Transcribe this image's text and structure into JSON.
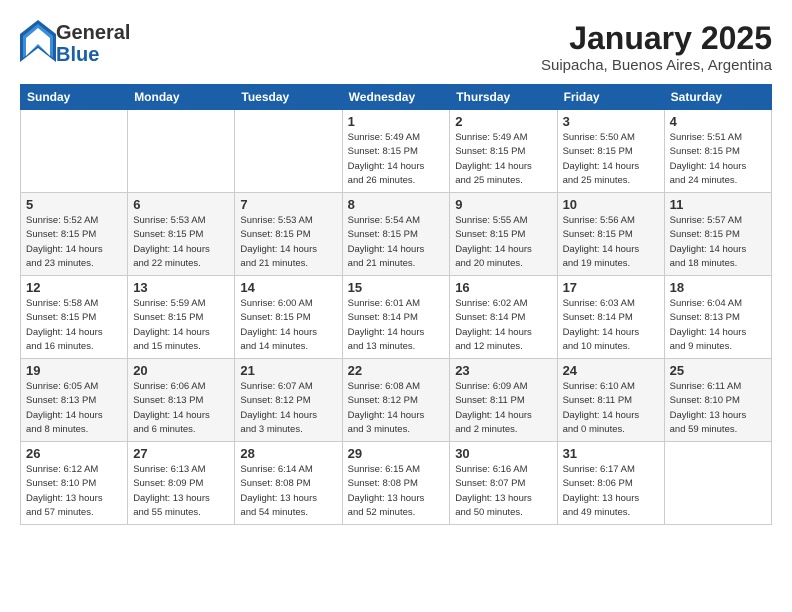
{
  "logo": {
    "general": "General",
    "blue": "Blue"
  },
  "title": "January 2025",
  "subtitle": "Suipacha, Buenos Aires, Argentina",
  "days_of_week": [
    "Sunday",
    "Monday",
    "Tuesday",
    "Wednesday",
    "Thursday",
    "Friday",
    "Saturday"
  ],
  "weeks": [
    [
      {
        "day": "",
        "info": ""
      },
      {
        "day": "",
        "info": ""
      },
      {
        "day": "",
        "info": ""
      },
      {
        "day": "1",
        "info": "Sunrise: 5:49 AM\nSunset: 8:15 PM\nDaylight: 14 hours\nand 26 minutes."
      },
      {
        "day": "2",
        "info": "Sunrise: 5:49 AM\nSunset: 8:15 PM\nDaylight: 14 hours\nand 25 minutes."
      },
      {
        "day": "3",
        "info": "Sunrise: 5:50 AM\nSunset: 8:15 PM\nDaylight: 14 hours\nand 25 minutes."
      },
      {
        "day": "4",
        "info": "Sunrise: 5:51 AM\nSunset: 8:15 PM\nDaylight: 14 hours\nand 24 minutes."
      }
    ],
    [
      {
        "day": "5",
        "info": "Sunrise: 5:52 AM\nSunset: 8:15 PM\nDaylight: 14 hours\nand 23 minutes."
      },
      {
        "day": "6",
        "info": "Sunrise: 5:53 AM\nSunset: 8:15 PM\nDaylight: 14 hours\nand 22 minutes."
      },
      {
        "day": "7",
        "info": "Sunrise: 5:53 AM\nSunset: 8:15 PM\nDaylight: 14 hours\nand 21 minutes."
      },
      {
        "day": "8",
        "info": "Sunrise: 5:54 AM\nSunset: 8:15 PM\nDaylight: 14 hours\nand 21 minutes."
      },
      {
        "day": "9",
        "info": "Sunrise: 5:55 AM\nSunset: 8:15 PM\nDaylight: 14 hours\nand 20 minutes."
      },
      {
        "day": "10",
        "info": "Sunrise: 5:56 AM\nSunset: 8:15 PM\nDaylight: 14 hours\nand 19 minutes."
      },
      {
        "day": "11",
        "info": "Sunrise: 5:57 AM\nSunset: 8:15 PM\nDaylight: 14 hours\nand 18 minutes."
      }
    ],
    [
      {
        "day": "12",
        "info": "Sunrise: 5:58 AM\nSunset: 8:15 PM\nDaylight: 14 hours\nand 16 minutes."
      },
      {
        "day": "13",
        "info": "Sunrise: 5:59 AM\nSunset: 8:15 PM\nDaylight: 14 hours\nand 15 minutes."
      },
      {
        "day": "14",
        "info": "Sunrise: 6:00 AM\nSunset: 8:15 PM\nDaylight: 14 hours\nand 14 minutes."
      },
      {
        "day": "15",
        "info": "Sunrise: 6:01 AM\nSunset: 8:14 PM\nDaylight: 14 hours\nand 13 minutes."
      },
      {
        "day": "16",
        "info": "Sunrise: 6:02 AM\nSunset: 8:14 PM\nDaylight: 14 hours\nand 12 minutes."
      },
      {
        "day": "17",
        "info": "Sunrise: 6:03 AM\nSunset: 8:14 PM\nDaylight: 14 hours\nand 10 minutes."
      },
      {
        "day": "18",
        "info": "Sunrise: 6:04 AM\nSunset: 8:13 PM\nDaylight: 14 hours\nand 9 minutes."
      }
    ],
    [
      {
        "day": "19",
        "info": "Sunrise: 6:05 AM\nSunset: 8:13 PM\nDaylight: 14 hours\nand 8 minutes."
      },
      {
        "day": "20",
        "info": "Sunrise: 6:06 AM\nSunset: 8:13 PM\nDaylight: 14 hours\nand 6 minutes."
      },
      {
        "day": "21",
        "info": "Sunrise: 6:07 AM\nSunset: 8:12 PM\nDaylight: 14 hours\nand 3 minutes."
      },
      {
        "day": "22",
        "info": "Sunrise: 6:08 AM\nSunset: 8:12 PM\nDaylight: 14 hours\nand 3 minutes."
      },
      {
        "day": "23",
        "info": "Sunrise: 6:09 AM\nSunset: 8:11 PM\nDaylight: 14 hours\nand 2 minutes."
      },
      {
        "day": "24",
        "info": "Sunrise: 6:10 AM\nSunset: 8:11 PM\nDaylight: 14 hours\nand 0 minutes."
      },
      {
        "day": "25",
        "info": "Sunrise: 6:11 AM\nSunset: 8:10 PM\nDaylight: 13 hours\nand 59 minutes."
      }
    ],
    [
      {
        "day": "26",
        "info": "Sunrise: 6:12 AM\nSunset: 8:10 PM\nDaylight: 13 hours\nand 57 minutes."
      },
      {
        "day": "27",
        "info": "Sunrise: 6:13 AM\nSunset: 8:09 PM\nDaylight: 13 hours\nand 55 minutes."
      },
      {
        "day": "28",
        "info": "Sunrise: 6:14 AM\nSunset: 8:08 PM\nDaylight: 13 hours\nand 54 minutes."
      },
      {
        "day": "29",
        "info": "Sunrise: 6:15 AM\nSunset: 8:08 PM\nDaylight: 13 hours\nand 52 minutes."
      },
      {
        "day": "30",
        "info": "Sunrise: 6:16 AM\nSunset: 8:07 PM\nDaylight: 13 hours\nand 50 minutes."
      },
      {
        "day": "31",
        "info": "Sunrise: 6:17 AM\nSunset: 8:06 PM\nDaylight: 13 hours\nand 49 minutes."
      },
      {
        "day": "",
        "info": ""
      }
    ]
  ]
}
